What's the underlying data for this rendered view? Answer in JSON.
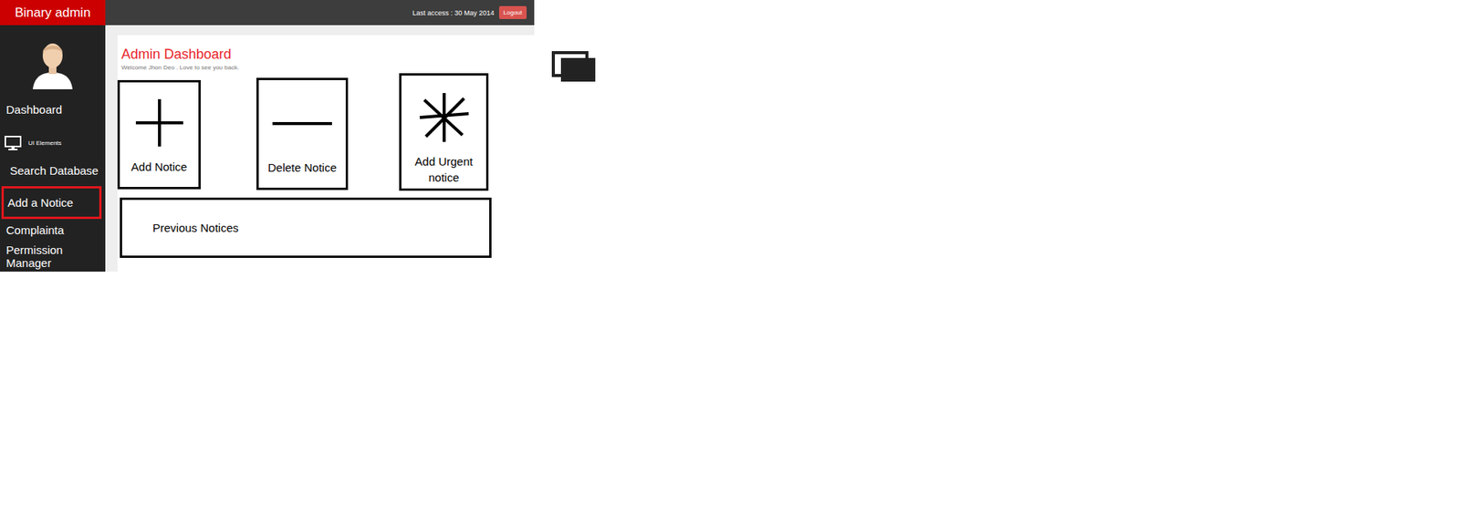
{
  "header": {
    "logo": "Binary admin",
    "last_access": "Last access : 30 May 2014",
    "logout": "Logout"
  },
  "sidebar": {
    "items": [
      {
        "label": "Dashboard",
        "kind": "plain",
        "selected": false
      },
      {
        "label": "UI Elements",
        "kind": "icon",
        "selected": false
      },
      {
        "label": "Search Database",
        "kind": "plain",
        "selected": false
      },
      {
        "label": "Add a Notice",
        "kind": "plain",
        "selected": true
      },
      {
        "label": "Complainta",
        "kind": "plain",
        "selected": false
      },
      {
        "label": "Permission Manager",
        "kind": "plain",
        "selected": false
      }
    ]
  },
  "content": {
    "title": "Admin Dashboard",
    "subtitle": "Welcome Jhon Deo . Love to see you back.",
    "actions": [
      {
        "label": "Add Notice",
        "kind": "plus"
      },
      {
        "label": "Delete Notice",
        "kind": "minus"
      },
      {
        "label": "Add Urgent notice",
        "kind": "asterisk"
      }
    ],
    "previous": "Previous Notices"
  }
}
